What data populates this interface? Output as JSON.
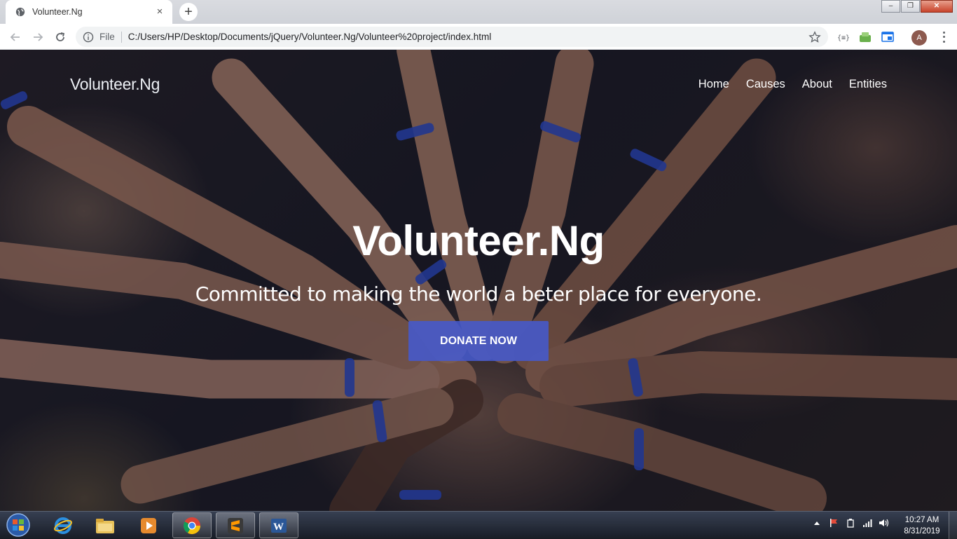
{
  "browser": {
    "tab_title": "Volunteer.Ng",
    "tab_close": "×",
    "new_tab": "+",
    "scheme_label": "File",
    "url": "C:/Users/HP/Desktop/Documents/jQuery/Volunteer.Ng/Volunteer%20project/index.html",
    "profile_initial": "A",
    "window_minimize": "–",
    "window_restore": "❐",
    "window_close": "✕"
  },
  "site": {
    "brand": "Volunteer.Ng",
    "nav": [
      "Home",
      "Causes",
      "About",
      "Entities"
    ],
    "hero_title": "Volunteer.Ng",
    "hero_tagline": "Committed to making the world a beter place for everyone.",
    "cta_label": "DONATE NOW"
  },
  "taskbar": {
    "time": "10:27 AM",
    "date": "8/31/2019"
  },
  "colors": {
    "cta": "#465acd",
    "nav_text": "#ffffff"
  }
}
